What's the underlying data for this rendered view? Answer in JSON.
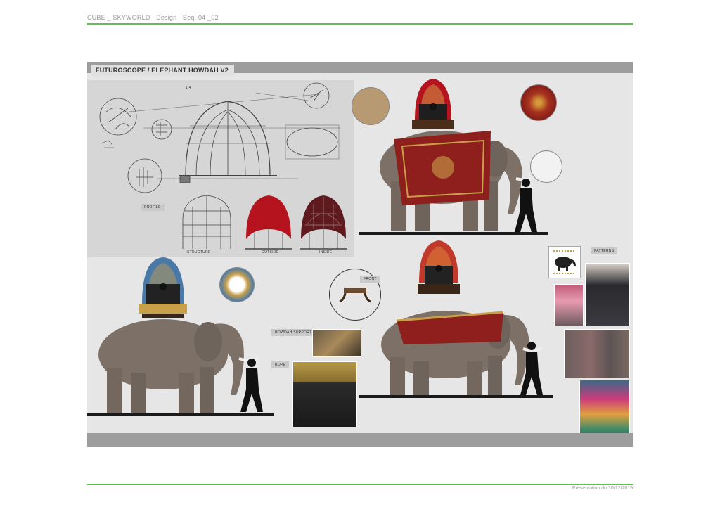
{
  "header": {
    "project_line": "CUBE _ SKYWORLD - Design - Seq. 04 _02"
  },
  "board": {
    "title": "FUTUROSCOPE / ELEPHANT HOWDAH V2",
    "scale_label": "1/4",
    "profile_label": "PROFILE",
    "dome_captions": [
      "STRUCTURE",
      "OUTSIDE",
      "INSIDE"
    ],
    "front_label": "FRONT",
    "howdah_support_label": "HOWDAH SUPPORT",
    "rope_label": "ROPE",
    "patterns_label": "PATTERNS"
  },
  "footer": {
    "date_line": "Présentation du 10/12/2015"
  },
  "colors": {
    "accent_line": "#5cc24a",
    "board_bg": "#e6e6e6",
    "board_band": "#9d9d9d",
    "elephant": "#7d7167",
    "drape_red": "#8e1f1c",
    "gold": "#c9a04a",
    "dome_red": "#b5141f"
  }
}
